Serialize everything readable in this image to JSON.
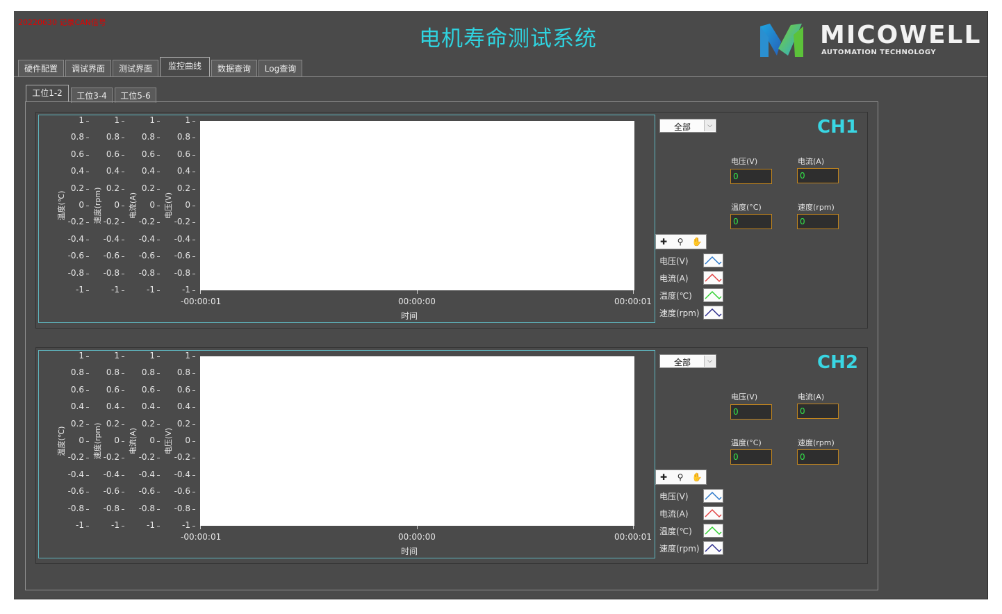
{
  "window": {
    "title": "电机寿命测试系统",
    "note": "20220630 记录CAN信号",
    "logo": {
      "brand": "MICOWELL",
      "tagline": "AUTOMATION TECHNOLOGY"
    }
  },
  "main_tabs": [
    {
      "label": "硬件配置",
      "active": false
    },
    {
      "label": "调试界面",
      "active": false
    },
    {
      "label": "测试界面",
      "active": false
    },
    {
      "label": "监控曲线",
      "active": true
    },
    {
      "label": "数据查询",
      "active": false
    },
    {
      "label": "Log查询",
      "active": false
    }
  ],
  "sub_tabs": [
    {
      "label": "工位1-2",
      "active": true
    },
    {
      "label": "工位3-4",
      "active": false
    },
    {
      "label": "工位5-6",
      "active": false
    }
  ],
  "y_ticks": [
    "1",
    "0.8",
    "0.6",
    "0.4",
    "0.2",
    "0",
    "-0.2",
    "-0.4",
    "-0.6",
    "-0.8",
    "-1"
  ],
  "y_axes": [
    "温度(℃)",
    "速度(rpm)",
    "电流(A)",
    "电压(V)"
  ],
  "x_ticks": [
    "-00:00:01",
    "00:00:00",
    "00:00:01"
  ],
  "x_label": "时间",
  "channels": [
    {
      "name": "CH1",
      "select": "全部",
      "fields": {
        "voltage": {
          "label": "电压(V)",
          "value": "0"
        },
        "current": {
          "label": "电流(A)",
          "value": "0"
        },
        "temperature": {
          "label": "温度(°C)",
          "value": "0"
        },
        "speed": {
          "label": "速度(rpm)",
          "value": "0"
        }
      },
      "legend": [
        {
          "label": "电压(V)",
          "color": "#2a77c9"
        },
        {
          "label": "电流(A)",
          "color": "#e04040"
        },
        {
          "label": "温度(℃)",
          "color": "#2fcf2f"
        },
        {
          "label": "速度(rpm)",
          "color": "#2a2a8a"
        }
      ]
    },
    {
      "name": "CH2",
      "select": "全部",
      "fields": {
        "voltage": {
          "label": "电压(V)",
          "value": "0"
        },
        "current": {
          "label": "电流(A)",
          "value": "0"
        },
        "temperature": {
          "label": "温度(°C)",
          "value": "0"
        },
        "speed": {
          "label": "速度(rpm)",
          "value": "0"
        }
      },
      "legend": [
        {
          "label": "电压(V)",
          "color": "#2a77c9"
        },
        {
          "label": "电流(A)",
          "color": "#e04040"
        },
        {
          "label": "温度(℃)",
          "color": "#2fcf2f"
        },
        {
          "label": "速度(rpm)",
          "color": "#2a2a8a"
        }
      ]
    }
  ],
  "colors": {
    "accent": "#2fd3df",
    "panel": "#4a4a4a",
    "field_text": "#33e64a",
    "field_border": "#c3861e"
  },
  "icons": [
    "crosshair-zoom-icon",
    "zoom-icon",
    "pan-hand-icon",
    "logo-m-icon"
  ]
}
